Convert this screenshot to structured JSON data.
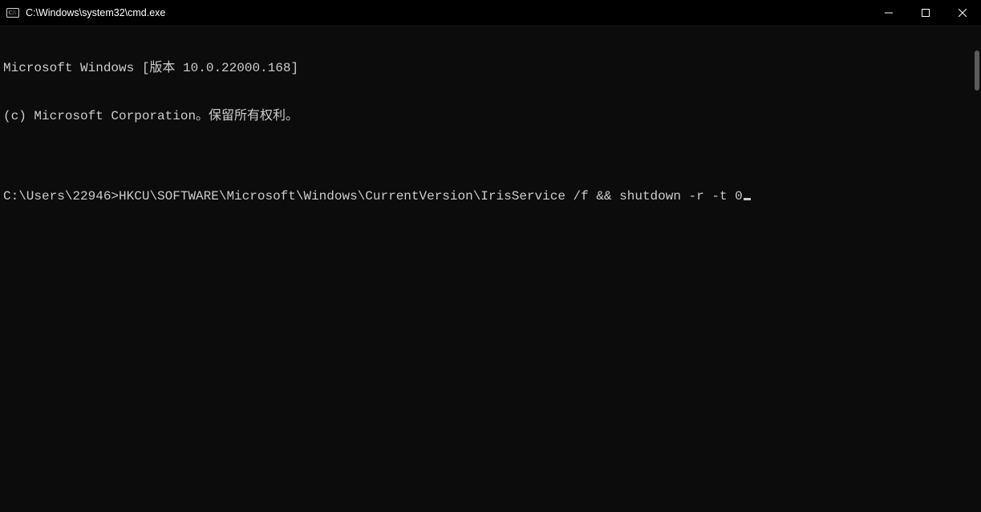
{
  "titlebar": {
    "title": "C:\\Windows\\system32\\cmd.exe"
  },
  "terminal": {
    "line1": "Microsoft Windows [版本 10.0.22000.168]",
    "line2": "(c) Microsoft Corporation。保留所有权利。",
    "blank": "",
    "prompt": "C:\\Users\\22946>",
    "command": "HKCU\\SOFTWARE\\Microsoft\\Windows\\CurrentVersion\\IrisService /f && shutdown -r -t 0"
  }
}
